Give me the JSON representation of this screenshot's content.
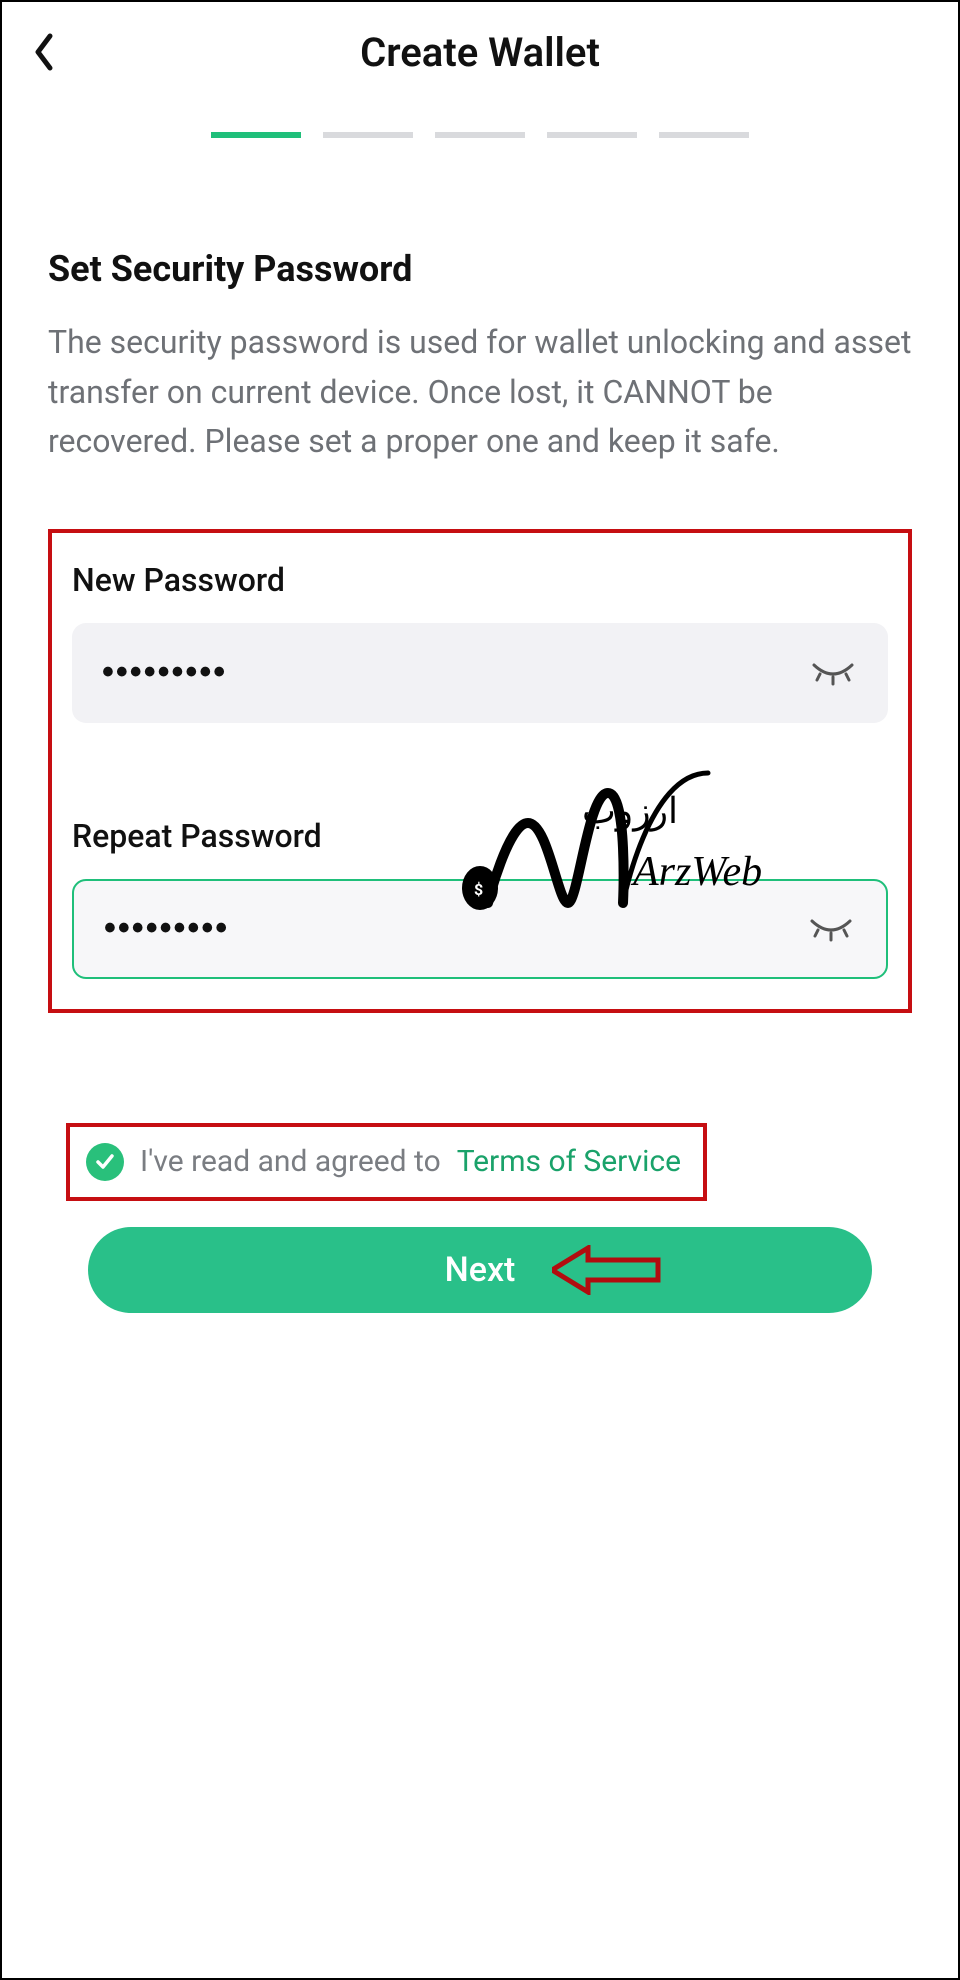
{
  "header": {
    "title": "Create Wallet"
  },
  "progress": {
    "total_steps": 5,
    "active_step": 1
  },
  "section": {
    "heading": "Set Security Password",
    "description": "The security password is used for wallet unlocking and asset transfer on current device. Once lost, it CANNOT be recovered. Please set a proper one and keep it safe."
  },
  "fields": {
    "new_password": {
      "label": "New Password",
      "masked_value": "•••••••••",
      "visible": false,
      "focused": false
    },
    "repeat_password": {
      "label": "Repeat Password",
      "masked_value": "•••••••••",
      "visible": false,
      "focused": true
    }
  },
  "terms": {
    "checked": true,
    "prefix": "I've read and agreed to ",
    "link_label": "Terms of Service"
  },
  "actions": {
    "next_label": "Next"
  },
  "colors": {
    "accent": "#29c089",
    "annotation": "#c60e12"
  },
  "watermark": {
    "brand_latin": "ArzWeb",
    "brand_persian": "ارزوب"
  }
}
